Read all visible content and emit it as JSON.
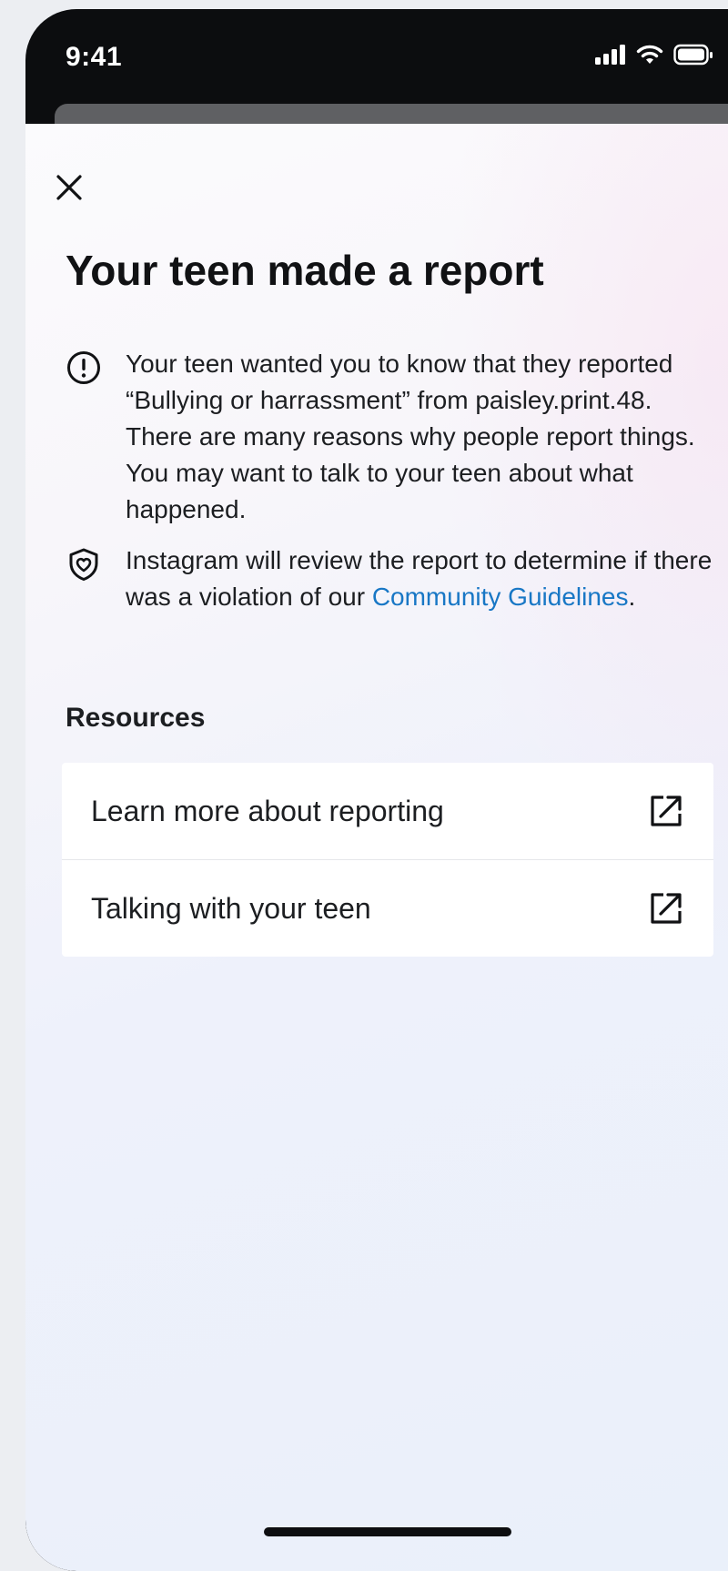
{
  "status_bar": {
    "time": "9:41"
  },
  "sheet": {
    "title": "Your teen made a report",
    "info": [
      {
        "icon": "alert-circle-icon",
        "text": "Your teen wanted you to know that they reported “Bullying or harrassment” from paisley.print.48. There are many reasons why people report things. You may want to talk to your teen about what happened."
      },
      {
        "icon": "shield-icon",
        "text_before_link": "Instagram will review the report to determine if there was a violation of our ",
        "link": "Community Guidelines",
        "text_after_link": "."
      }
    ],
    "resources": {
      "title": "Resources",
      "items": [
        {
          "label": "Learn more about reporting",
          "icon": "external-link-icon"
        },
        {
          "label": "Talking with your teen",
          "icon": "external-link-icon"
        }
      ]
    }
  },
  "colors": {
    "accent_link": "#1877c5",
    "text_primary": "#1c1e21",
    "status_bar_bg": "#0c0d0f"
  }
}
